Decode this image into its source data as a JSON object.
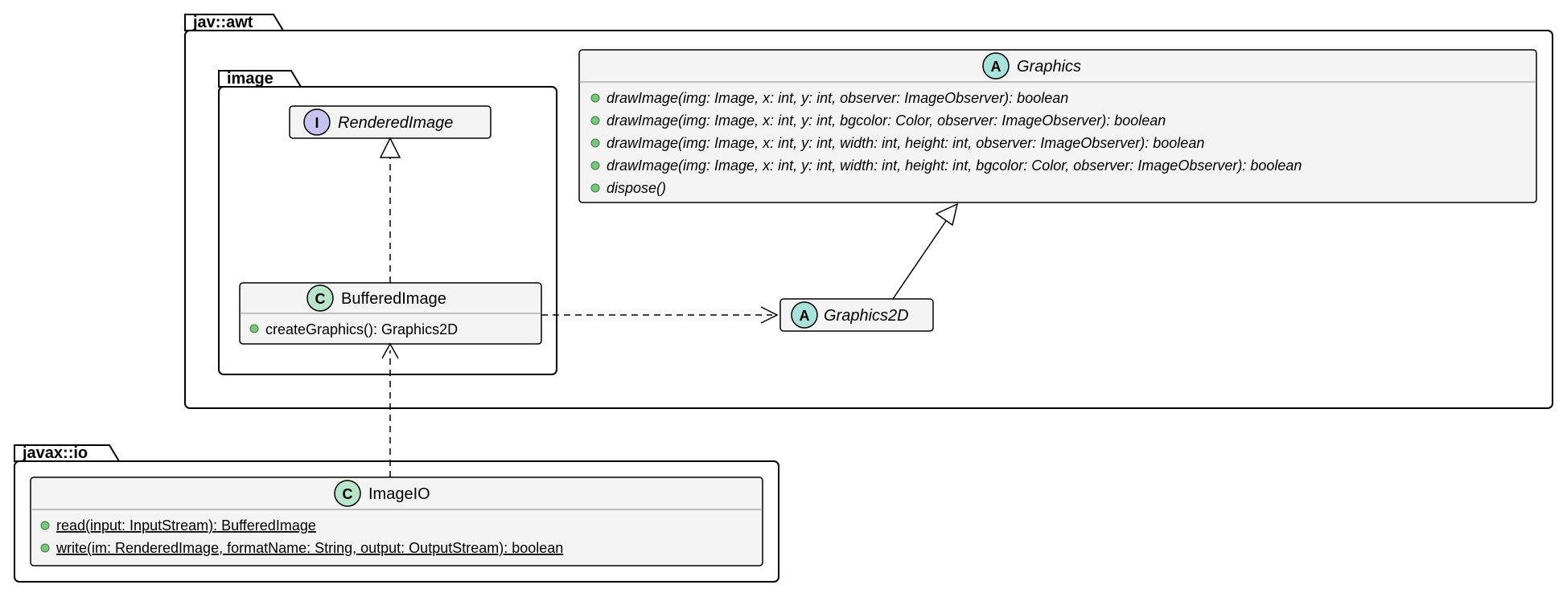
{
  "packages": {
    "awt": {
      "label": "jav::awt"
    },
    "image": {
      "label": "image"
    },
    "io": {
      "label": "javax::io"
    }
  },
  "classes": {
    "renderedImage": {
      "badge": "I",
      "name": "RenderedImage"
    },
    "bufferedImage": {
      "badge": "C",
      "name": "BufferedImage",
      "members": {
        "m0": "createGraphics(): Graphics2D"
      }
    },
    "graphics": {
      "badge": "A",
      "name": "Graphics",
      "members": {
        "m0": "drawImage(img: Image, x: int, y: int, observer: ImageObserver): boolean",
        "m1": "drawImage(img: Image, x: int, y: int, bgcolor: Color, observer: ImageObserver): boolean",
        "m2": "drawImage(img: Image, x: int, y: int, width: int, height: int, observer: ImageObserver): boolean",
        "m3": "drawImage(img: Image, x: int, y: int, width: int, height: int, bgcolor: Color, observer: ImageObserver): boolean",
        "m4": "dispose()"
      }
    },
    "graphics2d": {
      "badge": "A",
      "name": "Graphics2D"
    },
    "imageIO": {
      "badge": "C",
      "name": "ImageIO",
      "members": {
        "m0": "read(input: InputStream): BufferedImage",
        "m1": "write(im: RenderedImage, formatName: String, output: OutputStream): boolean"
      }
    }
  }
}
